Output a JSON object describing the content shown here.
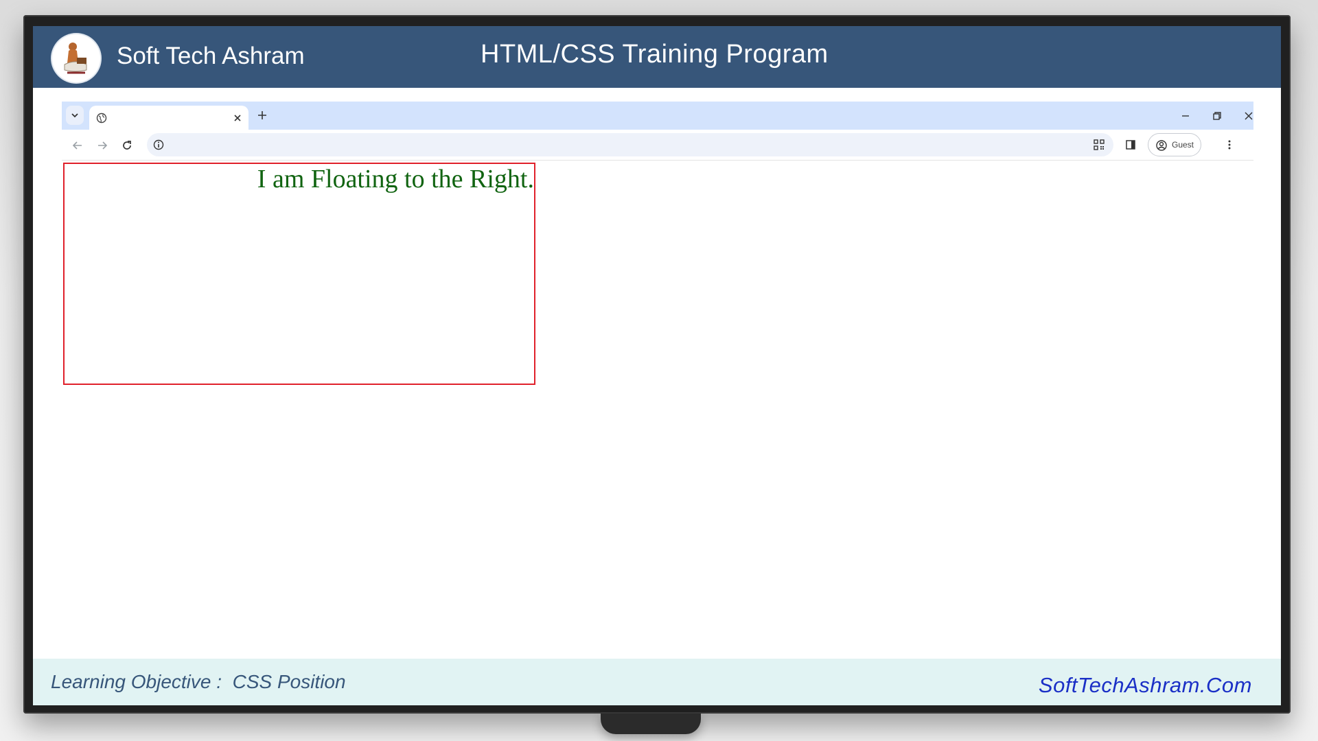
{
  "banner": {
    "brand": "Soft Tech Ashram",
    "program_title": "HTML/CSS Training Program",
    "color": "#37567a"
  },
  "browser": {
    "tab": {
      "favicon": "globe-icon",
      "close": "close-icon"
    },
    "new_tab": "plus-icon",
    "window_controls": [
      "minimize-icon",
      "restore-icon",
      "close-icon"
    ],
    "toolbar": {
      "back": "arrow-left-icon",
      "forward": "arrow-right-icon",
      "reload": "reload-icon",
      "site_info": "info-icon",
      "address_value": "",
      "qr": "qr-code-icon",
      "side_panel": "side-panel-icon",
      "profile_label": "Guest",
      "menu": "kebab-menu-icon"
    },
    "accent": "#d3e3fd"
  },
  "page": {
    "float_text": "I am Floating to the Right.",
    "text_color": "#116411",
    "box_border_color": "#e0202a"
  },
  "footer": {
    "objective": "Learning Objective :  CSS Position",
    "site": "SoftTechAshram.Com",
    "background": "#e1f3f3"
  }
}
